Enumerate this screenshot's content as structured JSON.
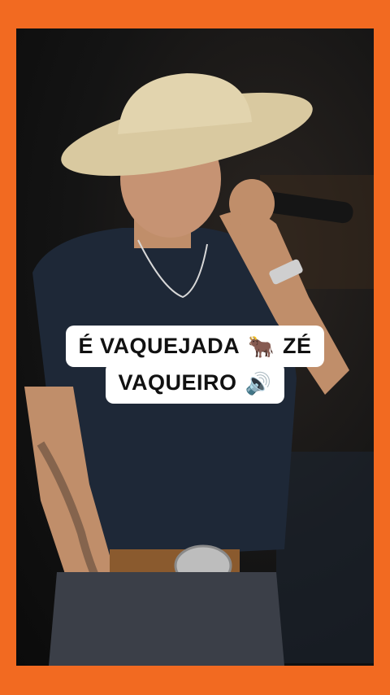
{
  "video": {
    "caption_line1": "É VAQUEJADA",
    "caption_emoji1": "🐂",
    "caption_line1_tail": "ZÉ",
    "caption_line2": "VAQUEIRO",
    "caption_emoji2": "🔊"
  },
  "colors": {
    "frame": "#f26a21",
    "caption_bg": "#ffffff",
    "caption_text": "#111111"
  }
}
